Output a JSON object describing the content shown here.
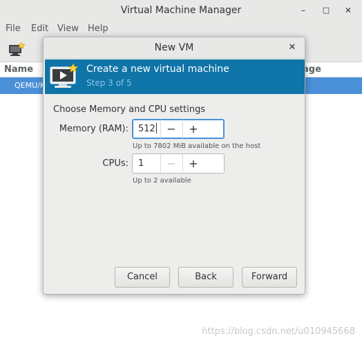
{
  "main_window": {
    "title": "Virtual Machine Manager",
    "wm_buttons": {
      "minimize": "–",
      "maximize": "□",
      "close": "✕"
    },
    "menu": [
      "File",
      "Edit",
      "View",
      "Help"
    ],
    "toolbar": {
      "new_vm_icon": "monitor-new-icon"
    },
    "list": {
      "col_name": "Name",
      "col_usage_fragment": "age",
      "rows": [
        {
          "name_fragment": "QEMU/K",
          "selected": true
        }
      ]
    }
  },
  "dialog": {
    "title": "New VM",
    "close_glyph": "✕",
    "banner": {
      "title": "Create a new virtual machine",
      "step": "Step 3 of 5",
      "icon": "vm-screen-new-icon",
      "background": "#0f74a8"
    },
    "section_title": "Choose Memory and CPU settings",
    "memory": {
      "label": "Memory (RAM):",
      "value": "512",
      "hint": "Up to 7802 MiB available on the host",
      "minus": "−",
      "plus": "+"
    },
    "cpus": {
      "label": "CPUs:",
      "value": "1",
      "hint": "Up to 2 available",
      "minus": "−",
      "plus": "+",
      "minus_disabled": true
    },
    "buttons": {
      "cancel": "Cancel",
      "back": "Back",
      "forward": "Forward"
    }
  },
  "watermark": "https://blog.csdn.net/u010945668",
  "colors": {
    "selection": "#4a90d9",
    "banner": "#0f74a8"
  }
}
